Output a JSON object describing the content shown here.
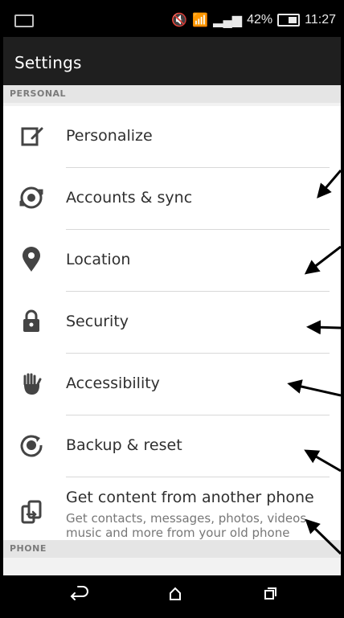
{
  "statusbar": {
    "battery_percent": "42%",
    "time": "11:27"
  },
  "app": {
    "title": "Settings"
  },
  "sections": [
    {
      "label": "PERSONAL"
    },
    {
      "label": "PHONE"
    }
  ],
  "items": [
    {
      "icon": "personalize-icon",
      "label": "Personalize"
    },
    {
      "icon": "sync-icon",
      "label": "Accounts & sync"
    },
    {
      "icon": "location-pin-icon",
      "label": "Location"
    },
    {
      "icon": "lock-icon",
      "label": "Security"
    },
    {
      "icon": "hand-icon",
      "label": "Accessibility"
    },
    {
      "icon": "backup-reset-icon",
      "label": "Backup & reset"
    },
    {
      "icon": "transfer-phone-icon",
      "label": "Get content from another phone",
      "subtitle": "Get contacts, messages, photos, videos, music and more from your old phone"
    }
  ],
  "colors": {
    "statusbar": "#000000",
    "appbar": "#1f1f1f",
    "section_bg": "#e5e5e5",
    "text": "#2f2f2f",
    "subtext": "#777777"
  }
}
